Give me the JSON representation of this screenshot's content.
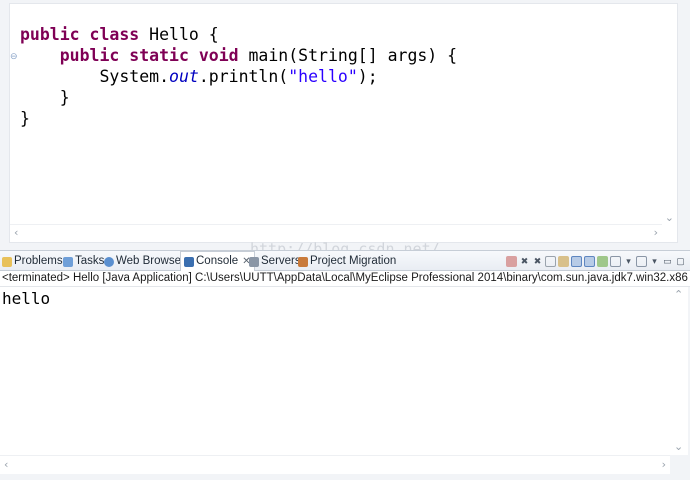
{
  "editor": {
    "lines": [
      [
        {
          "t": "public class",
          "c": "kw"
        },
        {
          "t": " Hello {",
          "c": ""
        }
      ],
      [
        {
          "t": "    ",
          "c": ""
        },
        {
          "t": "public static void",
          "c": "kw"
        },
        {
          "t": " main(String[] args) {",
          "c": ""
        }
      ],
      [
        {
          "t": "        System.",
          "c": ""
        },
        {
          "t": "out",
          "c": "fld"
        },
        {
          "t": ".println(",
          "c": ""
        },
        {
          "t": "\"hello\"",
          "c": "str"
        },
        {
          "t": ");",
          "c": ""
        }
      ],
      [
        {
          "t": "    }",
          "c": ""
        }
      ],
      [
        {
          "t": "}",
          "c": ""
        }
      ]
    ]
  },
  "tabs": [
    {
      "label": "Problems",
      "icon": "problems-icon",
      "active": false
    },
    {
      "label": "Tasks",
      "icon": "tasks-icon",
      "active": false
    },
    {
      "label": "Web Browser",
      "icon": "web-browser-icon",
      "active": false
    },
    {
      "label": "Console",
      "icon": "console-icon",
      "active": true
    },
    {
      "label": "Servers",
      "icon": "servers-icon",
      "active": false
    },
    {
      "label": "Project Migration",
      "icon": "project-migration-icon",
      "active": false
    }
  ],
  "console": {
    "header": "<terminated> Hello [Java Application] C:\\Users\\UUTT\\AppData\\Local\\MyEclipse Professional 2014\\binary\\com.sun.java.jdk7.win32.x86",
    "output": "hello"
  },
  "watermark": "http://blog.csdn.net/"
}
